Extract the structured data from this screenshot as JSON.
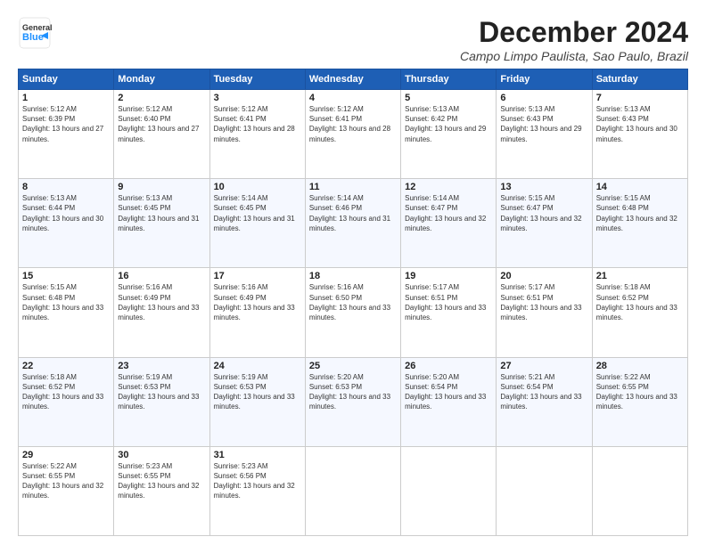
{
  "header": {
    "logo_line1": "General",
    "logo_line2": "Blue",
    "title": "December 2024",
    "subtitle": "Campo Limpo Paulista, Sao Paulo, Brazil"
  },
  "calendar": {
    "days_of_week": [
      "Sunday",
      "Monday",
      "Tuesday",
      "Wednesday",
      "Thursday",
      "Friday",
      "Saturday"
    ],
    "weeks": [
      [
        null,
        {
          "day": "2",
          "sunrise": "Sunrise: 5:12 AM",
          "sunset": "Sunset: 6:40 PM",
          "daylight": "Daylight: 13 hours and 27 minutes."
        },
        {
          "day": "3",
          "sunrise": "Sunrise: 5:12 AM",
          "sunset": "Sunset: 6:41 PM",
          "daylight": "Daylight: 13 hours and 28 minutes."
        },
        {
          "day": "4",
          "sunrise": "Sunrise: 5:12 AM",
          "sunset": "Sunset: 6:41 PM",
          "daylight": "Daylight: 13 hours and 28 minutes."
        },
        {
          "day": "5",
          "sunrise": "Sunrise: 5:13 AM",
          "sunset": "Sunset: 6:42 PM",
          "daylight": "Daylight: 13 hours and 29 minutes."
        },
        {
          "day": "6",
          "sunrise": "Sunrise: 5:13 AM",
          "sunset": "Sunset: 6:43 PM",
          "daylight": "Daylight: 13 hours and 29 minutes."
        },
        {
          "day": "7",
          "sunrise": "Sunrise: 5:13 AM",
          "sunset": "Sunset: 6:43 PM",
          "daylight": "Daylight: 13 hours and 30 minutes."
        }
      ],
      [
        {
          "day": "1",
          "sunrise": "Sunrise: 5:12 AM",
          "sunset": "Sunset: 6:39 PM",
          "daylight": "Daylight: 13 hours and 27 minutes."
        },
        null,
        null,
        null,
        null,
        null,
        null
      ],
      [
        {
          "day": "8",
          "sunrise": "Sunrise: 5:13 AM",
          "sunset": "Sunset: 6:44 PM",
          "daylight": "Daylight: 13 hours and 30 minutes."
        },
        {
          "day": "9",
          "sunrise": "Sunrise: 5:13 AM",
          "sunset": "Sunset: 6:45 PM",
          "daylight": "Daylight: 13 hours and 31 minutes."
        },
        {
          "day": "10",
          "sunrise": "Sunrise: 5:14 AM",
          "sunset": "Sunset: 6:45 PM",
          "daylight": "Daylight: 13 hours and 31 minutes."
        },
        {
          "day": "11",
          "sunrise": "Sunrise: 5:14 AM",
          "sunset": "Sunset: 6:46 PM",
          "daylight": "Daylight: 13 hours and 31 minutes."
        },
        {
          "day": "12",
          "sunrise": "Sunrise: 5:14 AM",
          "sunset": "Sunset: 6:47 PM",
          "daylight": "Daylight: 13 hours and 32 minutes."
        },
        {
          "day": "13",
          "sunrise": "Sunrise: 5:15 AM",
          "sunset": "Sunset: 6:47 PM",
          "daylight": "Daylight: 13 hours and 32 minutes."
        },
        {
          "day": "14",
          "sunrise": "Sunrise: 5:15 AM",
          "sunset": "Sunset: 6:48 PM",
          "daylight": "Daylight: 13 hours and 32 minutes."
        }
      ],
      [
        {
          "day": "15",
          "sunrise": "Sunrise: 5:15 AM",
          "sunset": "Sunset: 6:48 PM",
          "daylight": "Daylight: 13 hours and 33 minutes."
        },
        {
          "day": "16",
          "sunrise": "Sunrise: 5:16 AM",
          "sunset": "Sunset: 6:49 PM",
          "daylight": "Daylight: 13 hours and 33 minutes."
        },
        {
          "day": "17",
          "sunrise": "Sunrise: 5:16 AM",
          "sunset": "Sunset: 6:49 PM",
          "daylight": "Daylight: 13 hours and 33 minutes."
        },
        {
          "day": "18",
          "sunrise": "Sunrise: 5:16 AM",
          "sunset": "Sunset: 6:50 PM",
          "daylight": "Daylight: 13 hours and 33 minutes."
        },
        {
          "day": "19",
          "sunrise": "Sunrise: 5:17 AM",
          "sunset": "Sunset: 6:51 PM",
          "daylight": "Daylight: 13 hours and 33 minutes."
        },
        {
          "day": "20",
          "sunrise": "Sunrise: 5:17 AM",
          "sunset": "Sunset: 6:51 PM",
          "daylight": "Daylight: 13 hours and 33 minutes."
        },
        {
          "day": "21",
          "sunrise": "Sunrise: 5:18 AM",
          "sunset": "Sunset: 6:52 PM",
          "daylight": "Daylight: 13 hours and 33 minutes."
        }
      ],
      [
        {
          "day": "22",
          "sunrise": "Sunrise: 5:18 AM",
          "sunset": "Sunset: 6:52 PM",
          "daylight": "Daylight: 13 hours and 33 minutes."
        },
        {
          "day": "23",
          "sunrise": "Sunrise: 5:19 AM",
          "sunset": "Sunset: 6:53 PM",
          "daylight": "Daylight: 13 hours and 33 minutes."
        },
        {
          "day": "24",
          "sunrise": "Sunrise: 5:19 AM",
          "sunset": "Sunset: 6:53 PM",
          "daylight": "Daylight: 13 hours and 33 minutes."
        },
        {
          "day": "25",
          "sunrise": "Sunrise: 5:20 AM",
          "sunset": "Sunset: 6:53 PM",
          "daylight": "Daylight: 13 hours and 33 minutes."
        },
        {
          "day": "26",
          "sunrise": "Sunrise: 5:20 AM",
          "sunset": "Sunset: 6:54 PM",
          "daylight": "Daylight: 13 hours and 33 minutes."
        },
        {
          "day": "27",
          "sunrise": "Sunrise: 5:21 AM",
          "sunset": "Sunset: 6:54 PM",
          "daylight": "Daylight: 13 hours and 33 minutes."
        },
        {
          "day": "28",
          "sunrise": "Sunrise: 5:22 AM",
          "sunset": "Sunset: 6:55 PM",
          "daylight": "Daylight: 13 hours and 33 minutes."
        }
      ],
      [
        {
          "day": "29",
          "sunrise": "Sunrise: 5:22 AM",
          "sunset": "Sunset: 6:55 PM",
          "daylight": "Daylight: 13 hours and 32 minutes."
        },
        {
          "day": "30",
          "sunrise": "Sunrise: 5:23 AM",
          "sunset": "Sunset: 6:55 PM",
          "daylight": "Daylight: 13 hours and 32 minutes."
        },
        {
          "day": "31",
          "sunrise": "Sunrise: 5:23 AM",
          "sunset": "Sunset: 6:56 PM",
          "daylight": "Daylight: 13 hours and 32 minutes."
        },
        null,
        null,
        null,
        null
      ]
    ]
  }
}
